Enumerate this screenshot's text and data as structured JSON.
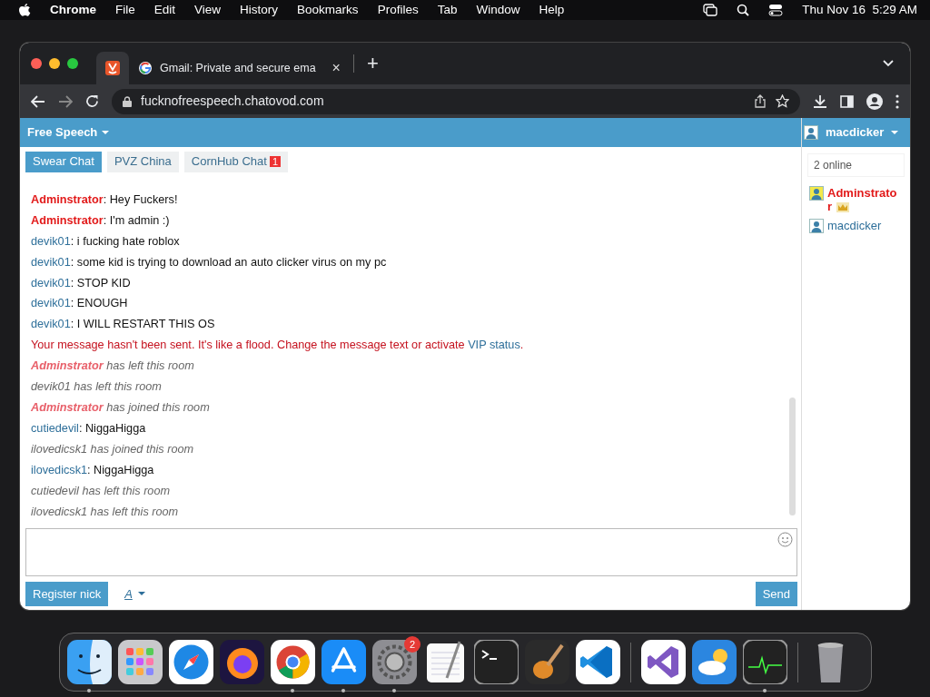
{
  "menu_bar": {
    "app": "Chrome",
    "items": [
      "File",
      "Edit",
      "View",
      "History",
      "Bookmarks",
      "Profiles",
      "Tab",
      "Window",
      "Help"
    ],
    "clock": "Thu Nov 16  5:29 AM"
  },
  "browser": {
    "tabs": [
      {
        "kind": "pinned",
        "selected": true
      },
      {
        "kind": "page",
        "title": "Gmail: Private and secure ema",
        "selected": false,
        "close": "×"
      }
    ],
    "new_tab": "+",
    "address": "fucknofreespeech.chatovod.com"
  },
  "chat": {
    "room_menu": "Free Speech",
    "user_menu": "macdicker",
    "rooms": [
      {
        "label": "Swear Chat",
        "selected": true
      },
      {
        "label": "PVZ China",
        "selected": false
      },
      {
        "label": "CornHub Chat",
        "selected": false,
        "badge": "1"
      }
    ],
    "messages": [
      {
        "kind": "message",
        "user": "Adminstrator",
        "admin": true,
        "text": ": Hey Fuckers!"
      },
      {
        "kind": "message",
        "user": "Adminstrator",
        "admin": true,
        "text": ": I'm admin :)"
      },
      {
        "kind": "message",
        "user": "devik01",
        "admin": false,
        "text": ": i fucking hate roblox"
      },
      {
        "kind": "message",
        "user": "devik01",
        "admin": false,
        "text": ": some kid is trying to download an auto clicker virus on my pc"
      },
      {
        "kind": "message",
        "user": "devik01",
        "admin": false,
        "text": ": STOP KID"
      },
      {
        "kind": "message",
        "user": "devik01",
        "admin": false,
        "text": ": ENOUGH"
      },
      {
        "kind": "message",
        "user": "devik01",
        "admin": false,
        "text": ": I WILL RESTART THIS OS"
      },
      {
        "kind": "error",
        "text": "Your message hasn't been sent. It's like a flood. Change the message text or activate",
        "link": "VIP status",
        "after": "."
      },
      {
        "kind": "event",
        "user": "Adminstrator",
        "admin": true,
        "text": " has left this room"
      },
      {
        "kind": "event",
        "user": "devik01",
        "admin": false,
        "text": " has left this room"
      },
      {
        "kind": "event",
        "user": "Adminstrator",
        "admin": true,
        "text": " has joined this room"
      },
      {
        "kind": "message",
        "user": "cutiedevil",
        "admin": false,
        "text": ": NiggaHigga"
      },
      {
        "kind": "event",
        "user": "ilovedicsk1",
        "admin": false,
        "text": " has joined this room"
      },
      {
        "kind": "message",
        "user": "ilovedicsk1",
        "admin": false,
        "text": ": NiggaHigga"
      },
      {
        "kind": "event",
        "user": "cutiedevil",
        "admin": false,
        "text": " has left this room"
      },
      {
        "kind": "event",
        "user": "ilovedicsk1",
        "admin": false,
        "text": " has left this room"
      }
    ],
    "online_count": "2 online",
    "users": [
      {
        "name": "Adminstrato",
        "name_wrap": "r",
        "admin": true
      },
      {
        "name": "macdicker",
        "admin": false
      }
    ],
    "register_button": "Register nick",
    "font_button": "A",
    "send_button": "Send"
  },
  "dock": {
    "apps": [
      {
        "kind": "finder",
        "running": true
      },
      {
        "kind": "launchpad",
        "running": false
      },
      {
        "kind": "safari",
        "running": false
      },
      {
        "kind": "firefox",
        "running": false
      },
      {
        "kind": "chrome",
        "running": true
      },
      {
        "kind": "appstore",
        "running": true
      },
      {
        "kind": "settings",
        "running": true,
        "badge": "2"
      },
      {
        "kind": "textedit",
        "running": false
      },
      {
        "kind": "terminal",
        "running": false
      },
      {
        "kind": "guitar",
        "running": false
      },
      {
        "kind": "vscode",
        "running": false
      },
      {
        "kind": "separator"
      },
      {
        "kind": "visualstudio",
        "running": false
      },
      {
        "kind": "weather",
        "running": false
      },
      {
        "kind": "activity",
        "running": true
      },
      {
        "kind": "separator"
      },
      {
        "kind": "trash",
        "running": false
      }
    ]
  }
}
